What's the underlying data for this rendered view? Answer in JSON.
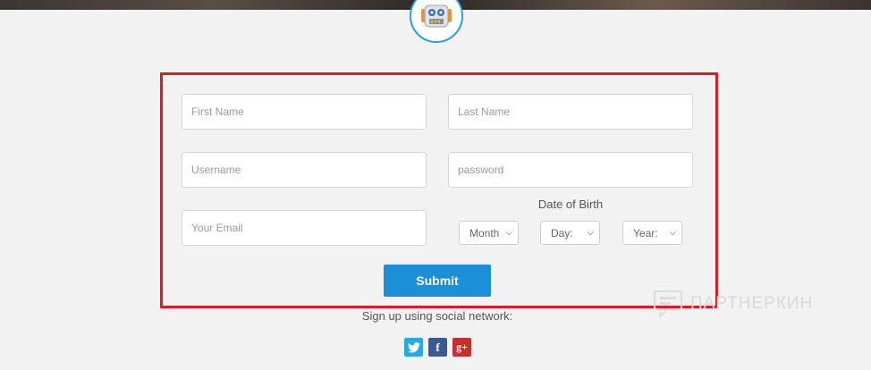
{
  "form": {
    "first_name_placeholder": "First Name",
    "last_name_placeholder": "Last Name",
    "username_placeholder": "Username",
    "password_placeholder": "password",
    "email_placeholder": "Your Email",
    "dob_label": "Date of Birth",
    "month_label": "Month",
    "day_label": "Day:",
    "year_label": "Year:",
    "submit_label": "Submit"
  },
  "social": {
    "heading": "Sign up using social network:",
    "networks": [
      {
        "name": "twitter",
        "icon": "twitter-icon",
        "color": "#2aa9e0"
      },
      {
        "name": "facebook",
        "icon": "facebook-icon",
        "color": "#3b5998",
        "glyph": "f"
      },
      {
        "name": "google-plus",
        "icon": "google-plus-icon",
        "color": "#c9302c",
        "glyph": "g+"
      }
    ]
  },
  "watermark": {
    "text": "ПАРТНЕРКИН"
  },
  "colors": {
    "accent": "#1b8fd8",
    "highlight_frame": "#e01b1b",
    "logo_ring": "#29a0d8"
  }
}
